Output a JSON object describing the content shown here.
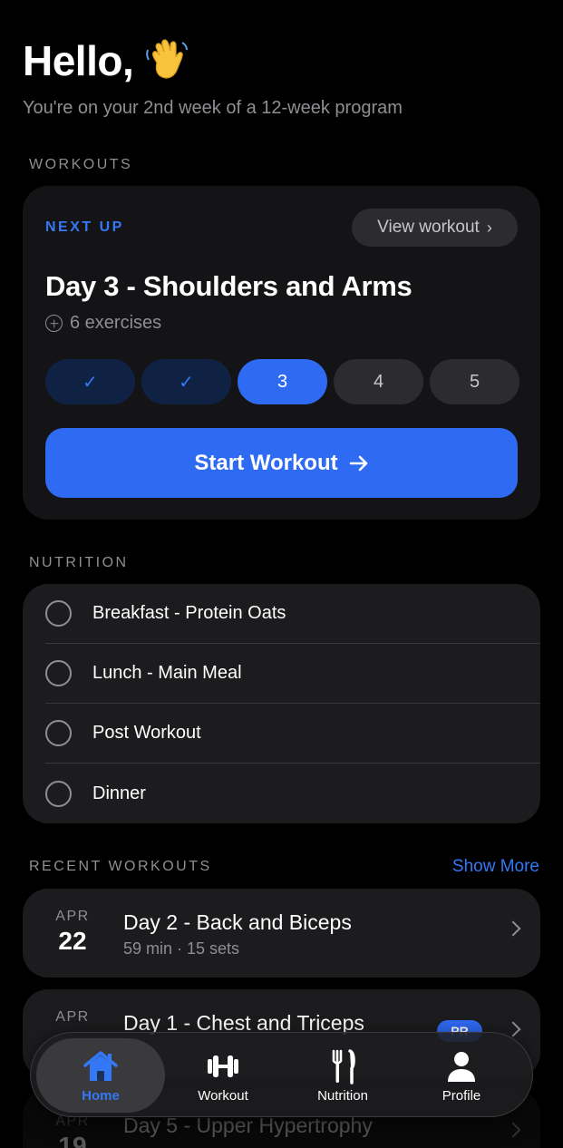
{
  "header": {
    "greeting": "Hello,",
    "wave_icon": "waving-hand-emoji",
    "subtitle": "You're on your 2nd week of a 12-week program"
  },
  "workouts": {
    "section_label": "WORKOUTS",
    "next_up_label": "NEXT UP",
    "view_workout_label": "View workout",
    "title": "Day 3 - Shoulders and Arms",
    "exercises_label": "6 exercises",
    "days": [
      {
        "label": "✓",
        "state": "done"
      },
      {
        "label": "✓",
        "state": "done"
      },
      {
        "label": "3",
        "state": "current"
      },
      {
        "label": "4",
        "state": "todo"
      },
      {
        "label": "5",
        "state": "todo"
      }
    ],
    "start_label": "Start Workout",
    "accent": "#2f6af3"
  },
  "nutrition": {
    "section_label": "NUTRITION",
    "meals": [
      {
        "label": "Breakfast - Protein Oats",
        "checked": false
      },
      {
        "label": "Lunch - Main Meal",
        "checked": false
      },
      {
        "label": "Post Workout",
        "checked": false
      },
      {
        "label": "Dinner",
        "checked": false
      }
    ]
  },
  "recent": {
    "section_label": "RECENT WORKOUTS",
    "show_more_label": "Show More",
    "items": [
      {
        "month": "APR",
        "day": "22",
        "title": "Day 2 - Back and Biceps",
        "meta": "59 min · 15 sets"
      },
      {
        "month": "APR",
        "day": "",
        "title": "Day 1 - Chest and Triceps",
        "meta": "",
        "badge": "PR"
      },
      {
        "month": "APR",
        "day": "19",
        "title": "Day 5 - Upper Hypertrophy",
        "meta": ""
      }
    ]
  },
  "tabbar": {
    "tabs": [
      {
        "label": "Home",
        "icon": "house-icon",
        "active": true
      },
      {
        "label": "Workout",
        "icon": "dumbbell-icon",
        "active": false
      },
      {
        "label": "Nutrition",
        "icon": "fork-knife-icon",
        "active": false
      },
      {
        "label": "Profile",
        "icon": "person-icon",
        "active": false
      }
    ]
  }
}
